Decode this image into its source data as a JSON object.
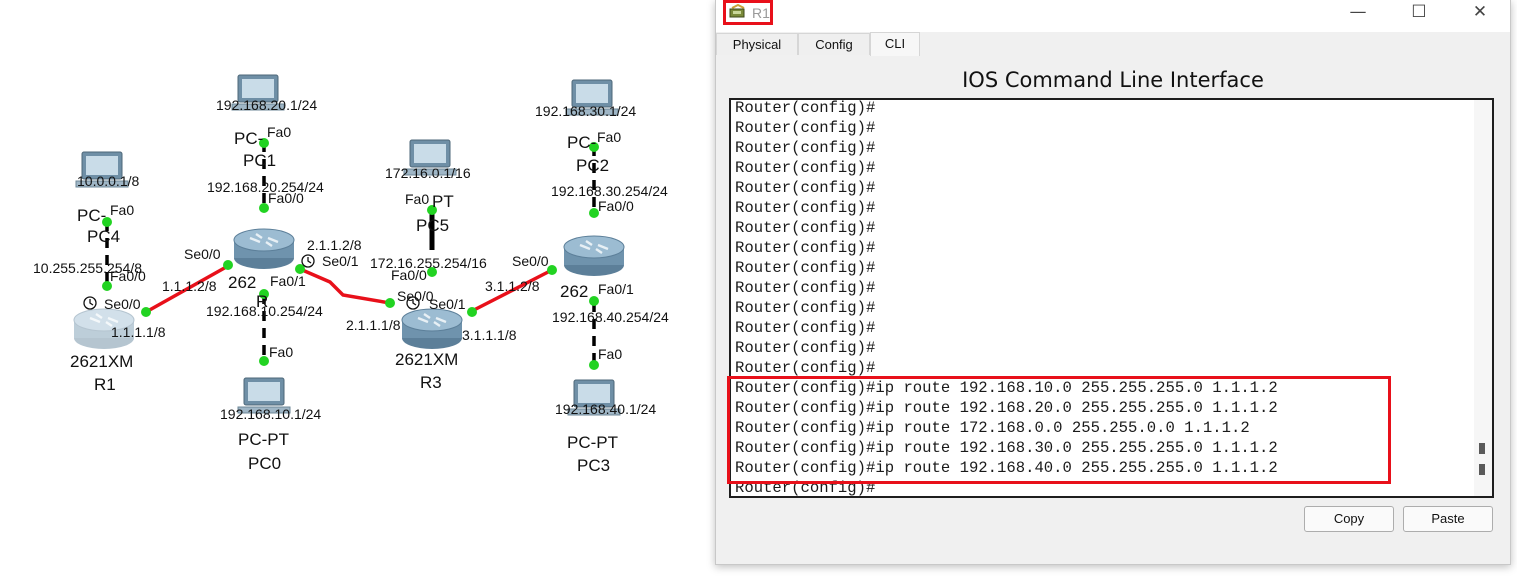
{
  "topology": {
    "pcs": {
      "pc0": {
        "ip": "192.168.10.1/24",
        "port": "Fa0",
        "model": "PC-PT",
        "name": "PC0"
      },
      "pc1": {
        "ip": "192.168.20.1/24",
        "port": "Fa0",
        "model": "PC-",
        "name": "PC1"
      },
      "pc2": {
        "ip": "192.168.30.1/24",
        "port": "Fa0",
        "model": "PC-",
        "name": "PC2"
      },
      "pc3": {
        "ip": "192.168.40.1/24",
        "port": "Fa0",
        "model": "PC-PT",
        "name": "PC3"
      },
      "pc4": {
        "ip": "10.0.0.1/8",
        "port": "Fa0",
        "model": "PC-",
        "name": "PC4"
      },
      "pc5": {
        "ip": "172.16.0.1/16",
        "port": "Fa0",
        "model": "PT",
        "name": "PC5"
      }
    },
    "routers": {
      "r1": {
        "model": "2621XM",
        "name": "R1",
        "lan_ip": "10.255.255.254/8",
        "lan_port": "Fa0/0",
        "wan_port": "Se0/0",
        "wan_ip": "1.1.1.1/8"
      },
      "r2": {
        "model": "262",
        "name": "R",
        "lan_top_ip": "192.168.20.254/24",
        "lan_top_port": "Fa0/0",
        "lan_bottom_port": "Fa0/1",
        "lan_bottom_ip": "192.168.10.254/24",
        "wan_left_port": "Se0/0",
        "wan_left_ip": "1.1.1.2/8",
        "wan_right_ip": "2.1.1.2/8",
        "wan_right_port": "Se0/1"
      },
      "r3": {
        "model": "2621XM",
        "name": "R3",
        "lan_ip": "172.16.255.254/16",
        "lan_port": "Fa0/0",
        "se00": "Se0/0",
        "wan_left_ip": "2.1.1.1/8",
        "se01": "Se0/1",
        "wan_right_ip": "3.1.1.1/8"
      },
      "r4": {
        "model": "262",
        "wan_port": "Se0/0",
        "wan_ip": "3.1.1.2/8",
        "lan_top_ip": "192.168.30.254/24",
        "lan_top_port": "Fa0/0",
        "lan_bottom_port": "Fa0/1",
        "lan_bottom_ip": "192.168.40.254/24"
      }
    }
  },
  "window": {
    "title": "R1",
    "tabs": [
      "Physical",
      "Config",
      "CLI"
    ],
    "active_tab": "CLI",
    "heading": "IOS Command Line Interface",
    "console_lines": [
      "Router(config)#",
      "Router(config)#",
      "Router(config)#",
      "Router(config)#",
      "Router(config)#",
      "Router(config)#",
      "Router(config)#",
      "Router(config)#",
      "Router(config)#",
      "Router(config)#",
      "Router(config)#",
      "Router(config)#",
      "Router(config)#",
      "Router(config)#",
      "Router(config)#ip route 192.168.10.0 255.255.255.0 1.1.1.2",
      "Router(config)#ip route 192.168.20.0 255.255.255.0 1.1.1.2",
      "Router(config)#ip route 172.168.0.0 255.255.0.0 1.1.1.2",
      "Router(config)#ip route 192.168.30.0 255.255.255.0 1.1.1.2",
      "Router(config)#ip route 192.168.40.0 255.255.255.0 1.1.1.2",
      "Router(config)#"
    ],
    "copy_label": "Copy",
    "paste_label": "Paste",
    "accent_color": "#e8101a"
  }
}
